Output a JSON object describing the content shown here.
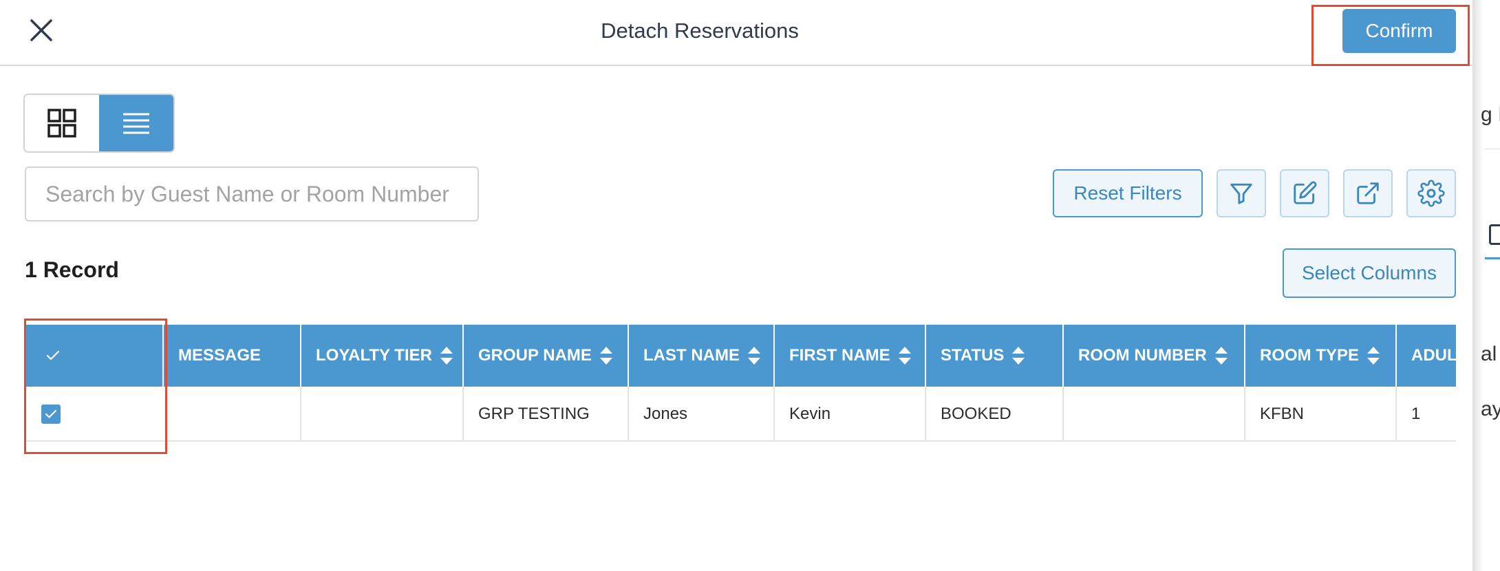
{
  "header": {
    "title": "Detach Reservations",
    "confirm_label": "Confirm"
  },
  "view_toggle": {
    "grid_icon": "grid-icon",
    "list_icon": "list-icon",
    "active": "list"
  },
  "search": {
    "placeholder": "Search by Guest Name or Room Number",
    "value": ""
  },
  "toolbar": {
    "reset_label": "Reset Filters",
    "icons": [
      "filter-icon",
      "edit-icon",
      "export-icon",
      "settings-icon"
    ],
    "select_columns_label": "Select Columns"
  },
  "records": {
    "count_label": "1 Record"
  },
  "table": {
    "columns": [
      {
        "label": "",
        "sortable": false
      },
      {
        "label": "MESSAGE",
        "sortable": false
      },
      {
        "label": "LOYALTY TIER",
        "sortable": true
      },
      {
        "label": "GROUP NAME",
        "sortable": true
      },
      {
        "label": "LAST NAME",
        "sortable": true
      },
      {
        "label": "FIRST NAME",
        "sortable": true
      },
      {
        "label": "STATUS",
        "sortable": true
      },
      {
        "label": "ROOM NUMBER",
        "sortable": true
      },
      {
        "label": "ROOM TYPE",
        "sortable": true
      },
      {
        "label": "ADULTS",
        "sortable": false
      }
    ],
    "rows": [
      {
        "selected": true,
        "cells": [
          "",
          "",
          "",
          "GRP TESTING",
          "Jones",
          "Kevin",
          "BOOKED",
          "",
          "KFBN",
          "1"
        ]
      }
    ]
  },
  "background_page": {
    "fragments": [
      "g I",
      "al",
      "ay"
    ]
  },
  "colors": {
    "accent": "#4a98cf",
    "highlight": "#e24a33",
    "title_text": "#2f3b4c"
  }
}
